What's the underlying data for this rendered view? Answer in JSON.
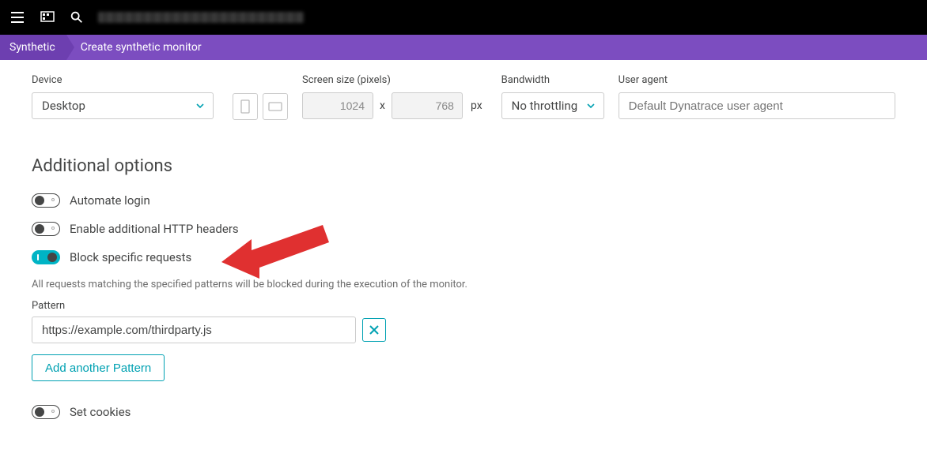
{
  "breadcrumbs": {
    "root": "Synthetic",
    "current": "Create synthetic monitor"
  },
  "deviceSection": {
    "deviceLabel": "Device",
    "deviceValue": "Desktop",
    "screenLabel": "Screen size (pixels)",
    "width": "1024",
    "height": "768",
    "x": "x",
    "px": "px",
    "bandwidthLabel": "Bandwidth",
    "bandwidthValue": "No throttling",
    "uaLabel": "User agent",
    "uaPlaceholder": "Default Dynatrace user agent"
  },
  "additional": {
    "title": "Additional options",
    "automate": "Automate login",
    "headers": "Enable additional HTTP headers",
    "block": "Block specific requests",
    "blockHelp": "All requests matching the specified patterns will be blocked during the execution of the monitor.",
    "patternLabel": "Pattern",
    "patternValue": "https://example.com/thirdparty.js",
    "addPattern": "Add another Pattern",
    "cookies": "Set cookies"
  }
}
